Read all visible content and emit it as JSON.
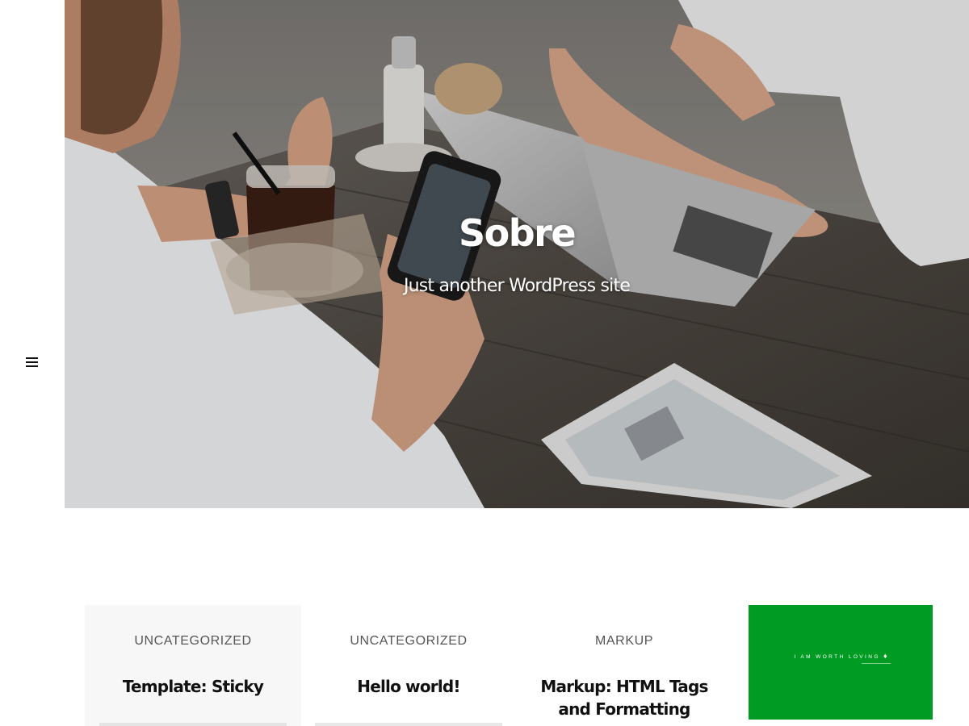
{
  "site": {
    "title": "Sobre",
    "tagline": "Just another WordPress site"
  },
  "sidebar": {
    "menu_icon": "hamburger-menu-icon"
  },
  "posts": [
    {
      "category": "UNCATEGORIZED",
      "title": "Template: Sticky"
    },
    {
      "category": "UNCATEGORIZED",
      "title": "Hello world!"
    },
    {
      "category": "MARKUP",
      "title": "Markup: HTML Tags and Formatting"
    }
  ],
  "featured_image": {
    "text": "I AM WORTH LOVING",
    "icon": "diamond-icon",
    "background": "#009b23"
  },
  "colors": {
    "accent_green": "#009b23",
    "text_dark": "#111111",
    "category_gray": "#555555"
  }
}
